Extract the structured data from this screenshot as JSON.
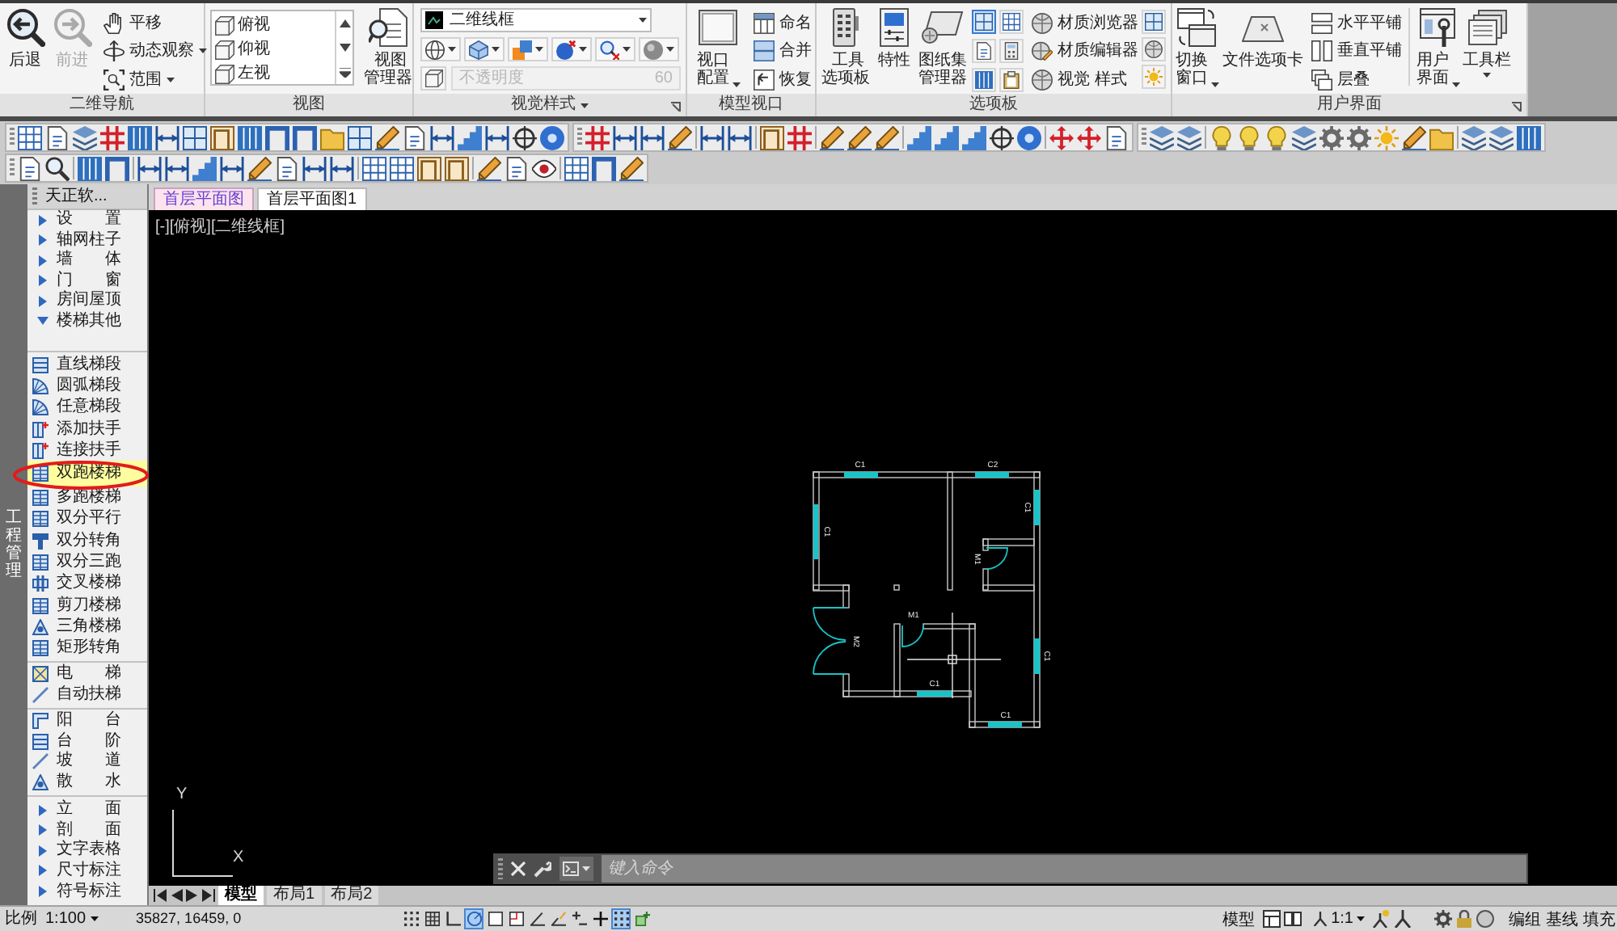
{
  "ribbon": {
    "navigation": {
      "title": "二维导航",
      "large_buttons": [
        {
          "label": "后退",
          "disabled": false
        },
        {
          "label": "前进",
          "disabled": true
        }
      ],
      "tools": [
        {
          "label": "平移",
          "dropdown": false
        },
        {
          "label": "动态观察",
          "dropdown": true
        },
        {
          "label": "范围",
          "dropdown": true
        }
      ]
    },
    "view": {
      "title": "视图",
      "views": [
        "俯视",
        "仰视",
        "左视"
      ],
      "manager": "视图管理器"
    },
    "visual_style": {
      "title": "视觉样式",
      "current_style": "二维线框",
      "opacity": {
        "label": "不透明度",
        "value": "60",
        "disabled": true
      }
    },
    "model_viewports": {
      "title": "模型视口",
      "config": {
        "label": "视口配置",
        "dropdown": true
      },
      "tools": [
        "命名",
        "合并",
        "恢复"
      ]
    },
    "palettes": {
      "title": "选项板",
      "large_buttons": [
        "工具选项板",
        "特性",
        "图纸集管理器"
      ],
      "toggles": [
        {
          "on": true
        },
        {
          "on": false
        },
        {
          "on": false
        },
        {
          "on": false
        },
        {
          "on": false
        },
        {
          "on": false
        }
      ],
      "tools": [
        "材质浏览器",
        "材质编辑器",
        "视觉 样式"
      ]
    },
    "user_interface": {
      "title": "用户界面",
      "large_buttons": [
        {
          "label": "切换窗口",
          "dropdown": true
        },
        {
          "label": "文件选项卡",
          "dropdown": false
        }
      ],
      "arrange": [
        "水平平铺",
        "垂直平铺",
        "层叠"
      ],
      "menus": [
        {
          "label": "用户界面",
          "dropdown": true
        },
        {
          "label": "工具栏",
          "dropdown": true
        }
      ]
    }
  },
  "sidebar": {
    "vertical_tab": "工程管理",
    "title": "天正软...",
    "sections": [
      {
        "items": [
          {
            "kind": "submenu",
            "label": "设　　置",
            "expanded": false,
            "selected": false,
            "circled": false
          },
          {
            "kind": "submenu",
            "label": "轴网柱子",
            "expanded": false,
            "selected": false,
            "circled": false
          },
          {
            "kind": "submenu",
            "label": "墙　　体",
            "expanded": false,
            "selected": false,
            "circled": false
          },
          {
            "kind": "submenu",
            "label": "门　　窗",
            "expanded": false,
            "selected": false,
            "circled": false
          },
          {
            "kind": "submenu",
            "label": "房间屋顶",
            "expanded": false,
            "selected": false,
            "circled": false
          },
          {
            "kind": "submenu",
            "label": "楼梯其他",
            "expanded": true,
            "selected": false,
            "circled": false
          }
        ]
      },
      {
        "items": [
          {
            "kind": "command",
            "label": "直线梯段",
            "selected": false,
            "circled": false
          },
          {
            "kind": "command",
            "label": "圆弧梯段",
            "selected": false,
            "circled": false
          },
          {
            "kind": "command",
            "label": "任意梯段",
            "selected": false,
            "circled": false
          },
          {
            "kind": "command",
            "label": "添加扶手",
            "selected": false,
            "circled": false
          },
          {
            "kind": "command",
            "label": "连接扶手",
            "selected": false,
            "circled": false
          },
          {
            "kind": "command",
            "label": "双跑楼梯",
            "selected": true,
            "circled": true
          },
          {
            "kind": "command",
            "label": "多跑楼梯",
            "selected": false,
            "circled": false
          },
          {
            "kind": "command",
            "label": "双分平行",
            "selected": false,
            "circled": false
          },
          {
            "kind": "command",
            "label": "双分转角",
            "selected": false,
            "circled": false
          },
          {
            "kind": "command",
            "label": "双分三跑",
            "selected": false,
            "circled": false
          },
          {
            "kind": "command",
            "label": "交叉楼梯",
            "selected": false,
            "circled": false
          },
          {
            "kind": "command",
            "label": "剪刀楼梯",
            "selected": false,
            "circled": false
          },
          {
            "kind": "command",
            "label": "三角楼梯",
            "selected": false,
            "circled": false
          },
          {
            "kind": "command",
            "label": "矩形转角",
            "selected": false,
            "circled": false
          }
        ]
      },
      {
        "items": [
          {
            "kind": "command",
            "label": "电　　梯",
            "selected": false,
            "circled": false
          },
          {
            "kind": "command",
            "label": "自动扶梯",
            "selected": false,
            "circled": false
          }
        ]
      },
      {
        "items": [
          {
            "kind": "command",
            "label": "阳　　台",
            "selected": false,
            "circled": false
          },
          {
            "kind": "command",
            "label": "台　　阶",
            "selected": false,
            "circled": false
          },
          {
            "kind": "command",
            "label": "坡　　道",
            "selected": false,
            "circled": false
          },
          {
            "kind": "command",
            "label": "散　　水",
            "selected": false,
            "circled": false
          }
        ]
      },
      {
        "items": [
          {
            "kind": "submenu",
            "label": "立　　面",
            "expanded": false,
            "selected": false,
            "circled": false
          },
          {
            "kind": "submenu",
            "label": "剖　　面",
            "expanded": false,
            "selected": false,
            "circled": false
          },
          {
            "kind": "submenu",
            "label": "文字表格",
            "expanded": false,
            "selected": false,
            "circled": false
          },
          {
            "kind": "submenu",
            "label": "尺寸标注",
            "expanded": false,
            "selected": false,
            "circled": false
          },
          {
            "kind": "submenu",
            "label": "符号标注",
            "expanded": false,
            "selected": false,
            "circled": false
          }
        ]
      }
    ]
  },
  "file_tabs": [
    {
      "label": "首层平面图",
      "selected": true
    },
    {
      "label": "首层平面图1",
      "selected": false
    }
  ],
  "viewport": {
    "label": "[-][俯视][二维线框]",
    "plan": {
      "windows": [
        {
          "label": "C1"
        },
        {
          "label": "C2"
        },
        {
          "label": "C1"
        },
        {
          "label": "C1"
        },
        {
          "label": "C1"
        },
        {
          "label": "C1"
        },
        {
          "label": "C1"
        }
      ],
      "doors": [
        {
          "label": "M2"
        },
        {
          "label": "M1"
        },
        {
          "label": "M1"
        }
      ]
    },
    "ucs": {
      "x": "X",
      "y": "Y"
    }
  },
  "command_line": {
    "placeholder": "键入命令"
  },
  "layout_tabs": [
    {
      "label": "模型",
      "selected": true
    },
    {
      "label": "布局1",
      "selected": false
    },
    {
      "label": "布局2",
      "selected": false
    }
  ],
  "status_bar": {
    "scale_label": "比例",
    "scale": "1:100",
    "coordinates": "35827, 16459, 0",
    "toggles": [
      {
        "on": false
      },
      {
        "on": false
      },
      {
        "on": false
      },
      {
        "on": true
      },
      {
        "on": false
      },
      {
        "on": false
      },
      {
        "on": false
      },
      {
        "on": false
      },
      {
        "on": false
      },
      {
        "on": false
      },
      {
        "on": true
      },
      {
        "on": false
      }
    ],
    "space": "模型",
    "annotation_scale": "1:1",
    "buttons": [
      "编组",
      "基线",
      "填充"
    ]
  }
}
